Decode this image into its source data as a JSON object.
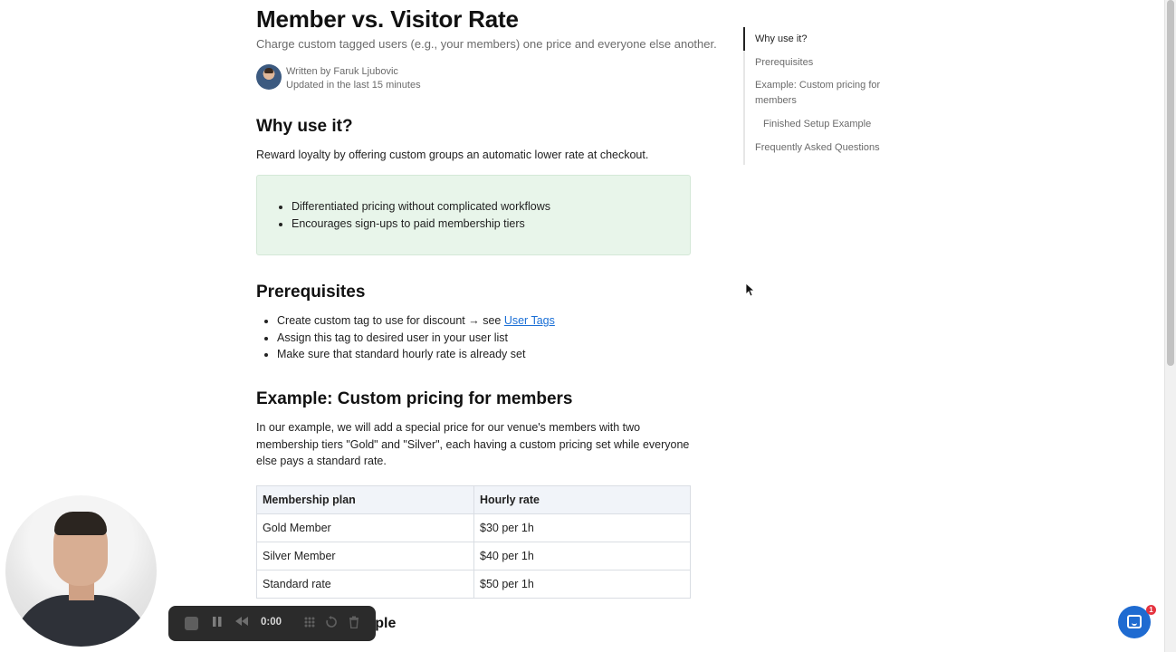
{
  "article": {
    "title": "Member vs. Visitor Rate",
    "subtitle": "Charge custom tagged users (e.g., your members) one price and everyone else another.",
    "author_line": "Written by Faruk Ljubovic",
    "updated_line": "Updated in the last 15 minutes",
    "why": {
      "heading": "Why use it?",
      "intro": "Reward loyalty by offering custom groups an automatic lower rate at checkout.",
      "bullets": [
        "Differentiated pricing without complicated workflows",
        "Encourages sign-ups to paid membership tiers"
      ]
    },
    "prereq": {
      "heading": "Prerequisites",
      "item1_text": "Create custom tag to use for discount → see ",
      "item1_link": "User Tags",
      "item2": "Assign this tag to desired user in your user list",
      "item3": "Make sure that standard hourly rate is already set"
    },
    "example": {
      "heading": "Example: Custom pricing for members",
      "paragraph": "In our example, we will add a special price for our venue's members with two membership tiers \"Gold\" and \"Silver\", each having a custom pricing set while everyone else pays a standard rate.",
      "table": {
        "headers": [
          "Membership plan",
          "Hourly rate"
        ],
        "rows": [
          [
            "Gold Member",
            "$30 per 1h"
          ],
          [
            "Silver Member",
            "$40 per 1h"
          ],
          [
            "Standard rate",
            "$50 per 1h"
          ]
        ]
      },
      "next_heading_partial": "mple"
    }
  },
  "toc": {
    "items": [
      "Why use it?",
      "Prerequisites",
      "Example: Custom pricing for members",
      "Finished Setup Example",
      "Frequently Asked Questions"
    ]
  },
  "recorder": {
    "time": "0:00",
    "icons": [
      "stop-icon",
      "pause-icon",
      "rewind-icon",
      "grid-icon",
      "restart-icon",
      "trash-icon"
    ]
  },
  "chat": {
    "badge_count": "1"
  },
  "colors": {
    "link": "#1a6fd6",
    "callout_bg": "#e8f5ea",
    "chat_button": "#1f6bd1",
    "badge": "#e5333f"
  }
}
